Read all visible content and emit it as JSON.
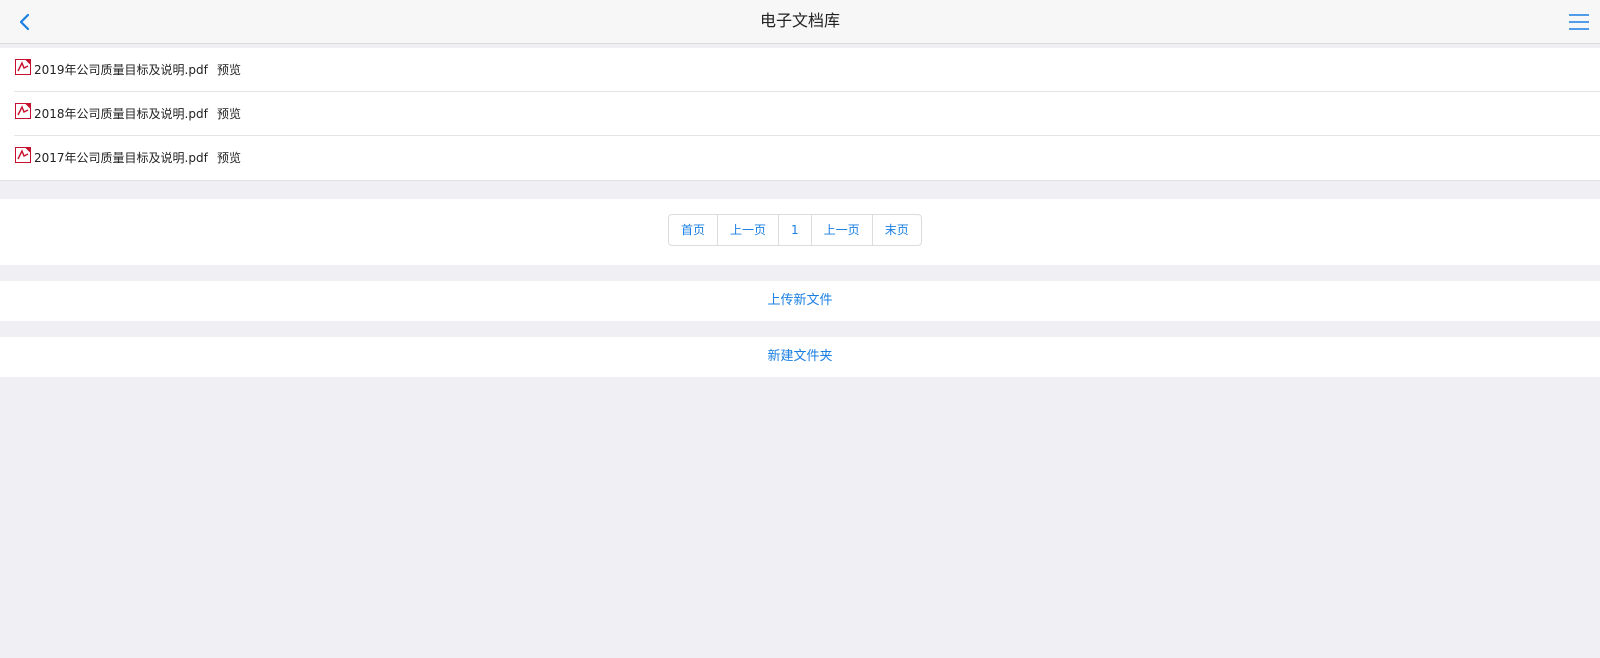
{
  "header": {
    "title": "电子文档库"
  },
  "files": [
    {
      "name": "2019年公司质量目标及说明.pdf",
      "preview_label": "预览"
    },
    {
      "name": "2018年公司质量目标及说明.pdf",
      "preview_label": "预览"
    },
    {
      "name": "2017年公司质量目标及说明.pdf",
      "preview_label": "预览"
    }
  ],
  "pagination": {
    "first_label": "首页",
    "prev_label": "上一页",
    "current_page": "1",
    "next_label": "上一页",
    "last_label": "末页"
  },
  "actions": {
    "upload_label": "上传新文件",
    "new_folder_label": "新建文件夹"
  },
  "icons": {
    "back": "chevron-left-icon",
    "menu": "hamburger-menu-icon",
    "file": "pdf-file-icon"
  },
  "colors": {
    "accent": "#1a7fe3",
    "background": "#efeff4",
    "pdf_red": "#c8102e"
  }
}
